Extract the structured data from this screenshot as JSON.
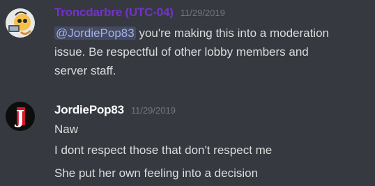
{
  "messages": [
    {
      "username": "Troncdarbre (UTC-04)",
      "username_color": "#7332cb",
      "timestamp": "11/29/2019",
      "avatar_icon": "anime-character-avatar",
      "content": {
        "mention": "@JordiePop83",
        "line1_rest": " you're making this into a moderation",
        "line2": "issue. Be respectful of other lobby members and",
        "line3": "server staff."
      }
    },
    {
      "username": "JordiePop83",
      "username_color": "#ffffff",
      "timestamp": "11/29/2019",
      "avatar_icon": "letter-j-logo-avatar",
      "avatar_letter": "J",
      "lines": [
        "Naw",
        "I dont respect those that don't respect me",
        "She put her own feeling into a decision"
      ]
    }
  ],
  "colors": {
    "background": "#36393f",
    "text": "#dcddde",
    "timestamp": "#72767d",
    "mention_text": "#a5b3ea",
    "avatar_red": "#d2162b"
  }
}
